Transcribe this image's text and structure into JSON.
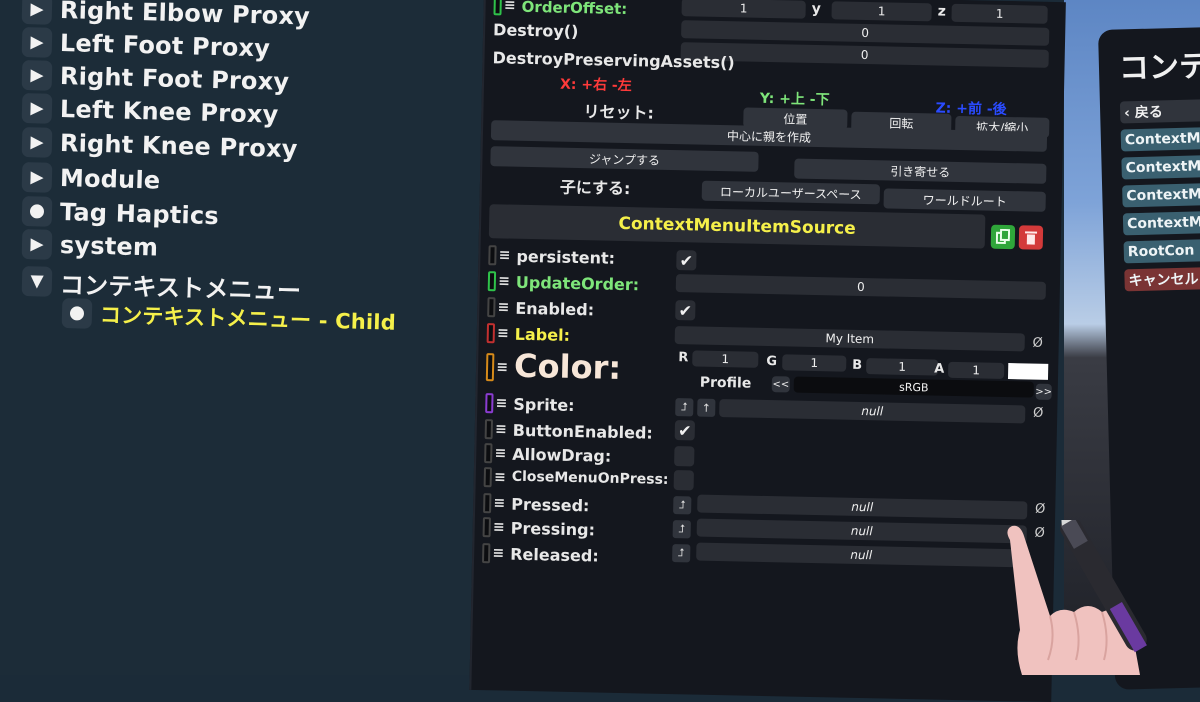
{
  "hierarchy": {
    "items": [
      {
        "label": "Right Elbow Proxy",
        "toggle": "triangle-right"
      },
      {
        "label": "Left Foot Proxy",
        "toggle": "triangle-right"
      },
      {
        "label": "Right Foot Proxy",
        "toggle": "triangle-right"
      },
      {
        "label": "Left Knee Proxy",
        "toggle": "triangle-right"
      },
      {
        "label": "Right Knee Proxy",
        "toggle": "triangle-right"
      },
      {
        "label": "Module",
        "toggle": "triangle-right"
      },
      {
        "label": "Tag Haptics",
        "toggle": "dot"
      },
      {
        "label": "system",
        "toggle": "triangle-right"
      },
      {
        "label": "コンテキストメニュー",
        "toggle": "triangle-down"
      }
    ],
    "child": {
      "label": "コンテキストメニュー - Child",
      "toggle": "dot"
    }
  },
  "inspector": {
    "order_offset_label": "OrderOffset:",
    "pos_y_axis": "y",
    "pos_z_axis": "z",
    "pos_values": [
      "1",
      "1",
      "0",
      "1"
    ],
    "order_offset_value": "0",
    "destroy": "Destroy()",
    "destroy_preserving": "DestroyPreservingAssets()",
    "axis_x": "X: +右 -左",
    "axis_y": "Y: +上 -下",
    "axis_z": "Z: +前 -後",
    "reset_label": "リセット:",
    "reset_position": "位置",
    "reset_rotation": "回転",
    "reset_scale": "拡大/縮小",
    "create_parent": "中心に親を作成",
    "jump": "ジャンプする",
    "pull": "引き寄せる",
    "child_of_label": "子にする:",
    "local_user_space": "ローカルユーザースペース",
    "world_root": "ワールドルート",
    "component_title": "ContextMenuItemSource",
    "fields": {
      "persistent": "persistent:",
      "update_order": "UpdateOrder:",
      "update_order_value": "0",
      "enabled": "Enabled:",
      "label": "Label:",
      "label_value": "My Item",
      "color": "Color:",
      "color_r_label": "R",
      "color_r": "1",
      "color_g_label": "G",
      "color_g": "1",
      "color_b_label": "B",
      "color_b": "1",
      "color_a_label": "A",
      "color_a": "1",
      "color_swatch": "#ffffff",
      "profile_label": "Profile",
      "profile_value": "sRGB",
      "profile_prev": "<<",
      "profile_next": ">>",
      "sprite": "Sprite:",
      "sprite_value": "null",
      "button_enabled": "ButtonEnabled:",
      "allow_drag": "AllowDrag:",
      "close_menu_on_press": "CloseMenuOnPress:",
      "pressed": "Pressed:",
      "pressed_value": "null",
      "pressing": "Pressing:",
      "pressing_value": "null",
      "released": "Released:",
      "released_value": "null"
    },
    "icons": {
      "check": "✔",
      "clear": "Ø",
      "jump": "⮥",
      "up": "↑"
    }
  },
  "context_menu": {
    "title": "コンテ",
    "back": "‹ 戻る",
    "items": [
      "ContextM",
      "ContextM",
      "ContextM",
      "ContextM",
      "RootCon"
    ],
    "cancel": "キャンセル"
  },
  "colors": {
    "accent_yellow": "#f5f04a",
    "accent_green": "#7ee57a",
    "accent_red": "#ff3a3a",
    "axis_blue": "#2a4bff",
    "panel_bg": "#14171e",
    "hierarchy_bg": "#1c2c38"
  }
}
